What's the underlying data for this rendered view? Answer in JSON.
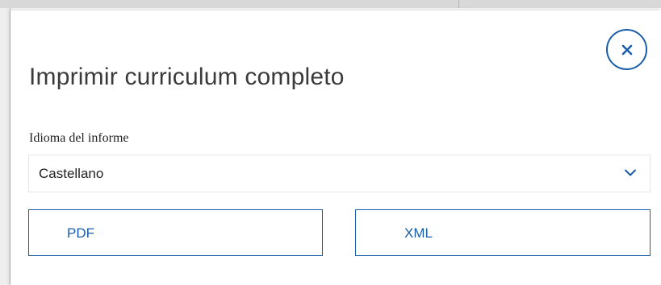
{
  "modal": {
    "title": "Imprimir curriculum completo",
    "close_icon": "close-icon"
  },
  "language_field": {
    "label": "Idioma del informe",
    "selected": "Castellano",
    "chevron_icon": "chevron-down-icon"
  },
  "export_buttons": {
    "pdf_label": "PDF",
    "xml_label": "XML"
  },
  "colors": {
    "accent": "#1b5ea8",
    "title_text": "#3a3a3a",
    "border": "#e6e6e6"
  }
}
